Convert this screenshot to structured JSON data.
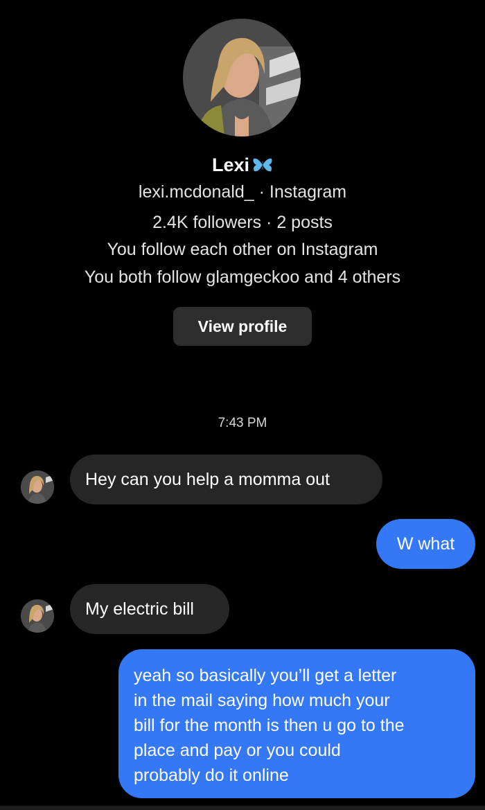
{
  "profile": {
    "display_name": "Lexi",
    "name_emoji_icon": "butterfly-icon",
    "handle_line": "lexi.mcdonald_ · Instagram",
    "stats_line": "2.4K followers · 2 posts",
    "follow_line": "You follow each other on Instagram",
    "mutual_line": "You both follow glamgeckoo and 4 others",
    "view_profile_label": "View profile"
  },
  "chat": {
    "timestamp": "7:43 PM",
    "messages": [
      {
        "from": "them",
        "text": "Hey can you help a momma out"
      },
      {
        "from": "me",
        "text": "W what"
      },
      {
        "from": "them",
        "text": "My electric bill"
      },
      {
        "from": "me",
        "lines": [
          "yeah so basically you’ll get a letter",
          "in the mail saying how much your",
          "bill for the month is then u go to the",
          "place and pay or you could",
          "probably do it online"
        ]
      }
    ]
  },
  "colors": {
    "background": "#000000",
    "incoming_bubble": "#262626",
    "outgoing_bubble": "#3478f6",
    "button": "#2e2e2e",
    "butterfly": "#5fb8e8"
  }
}
